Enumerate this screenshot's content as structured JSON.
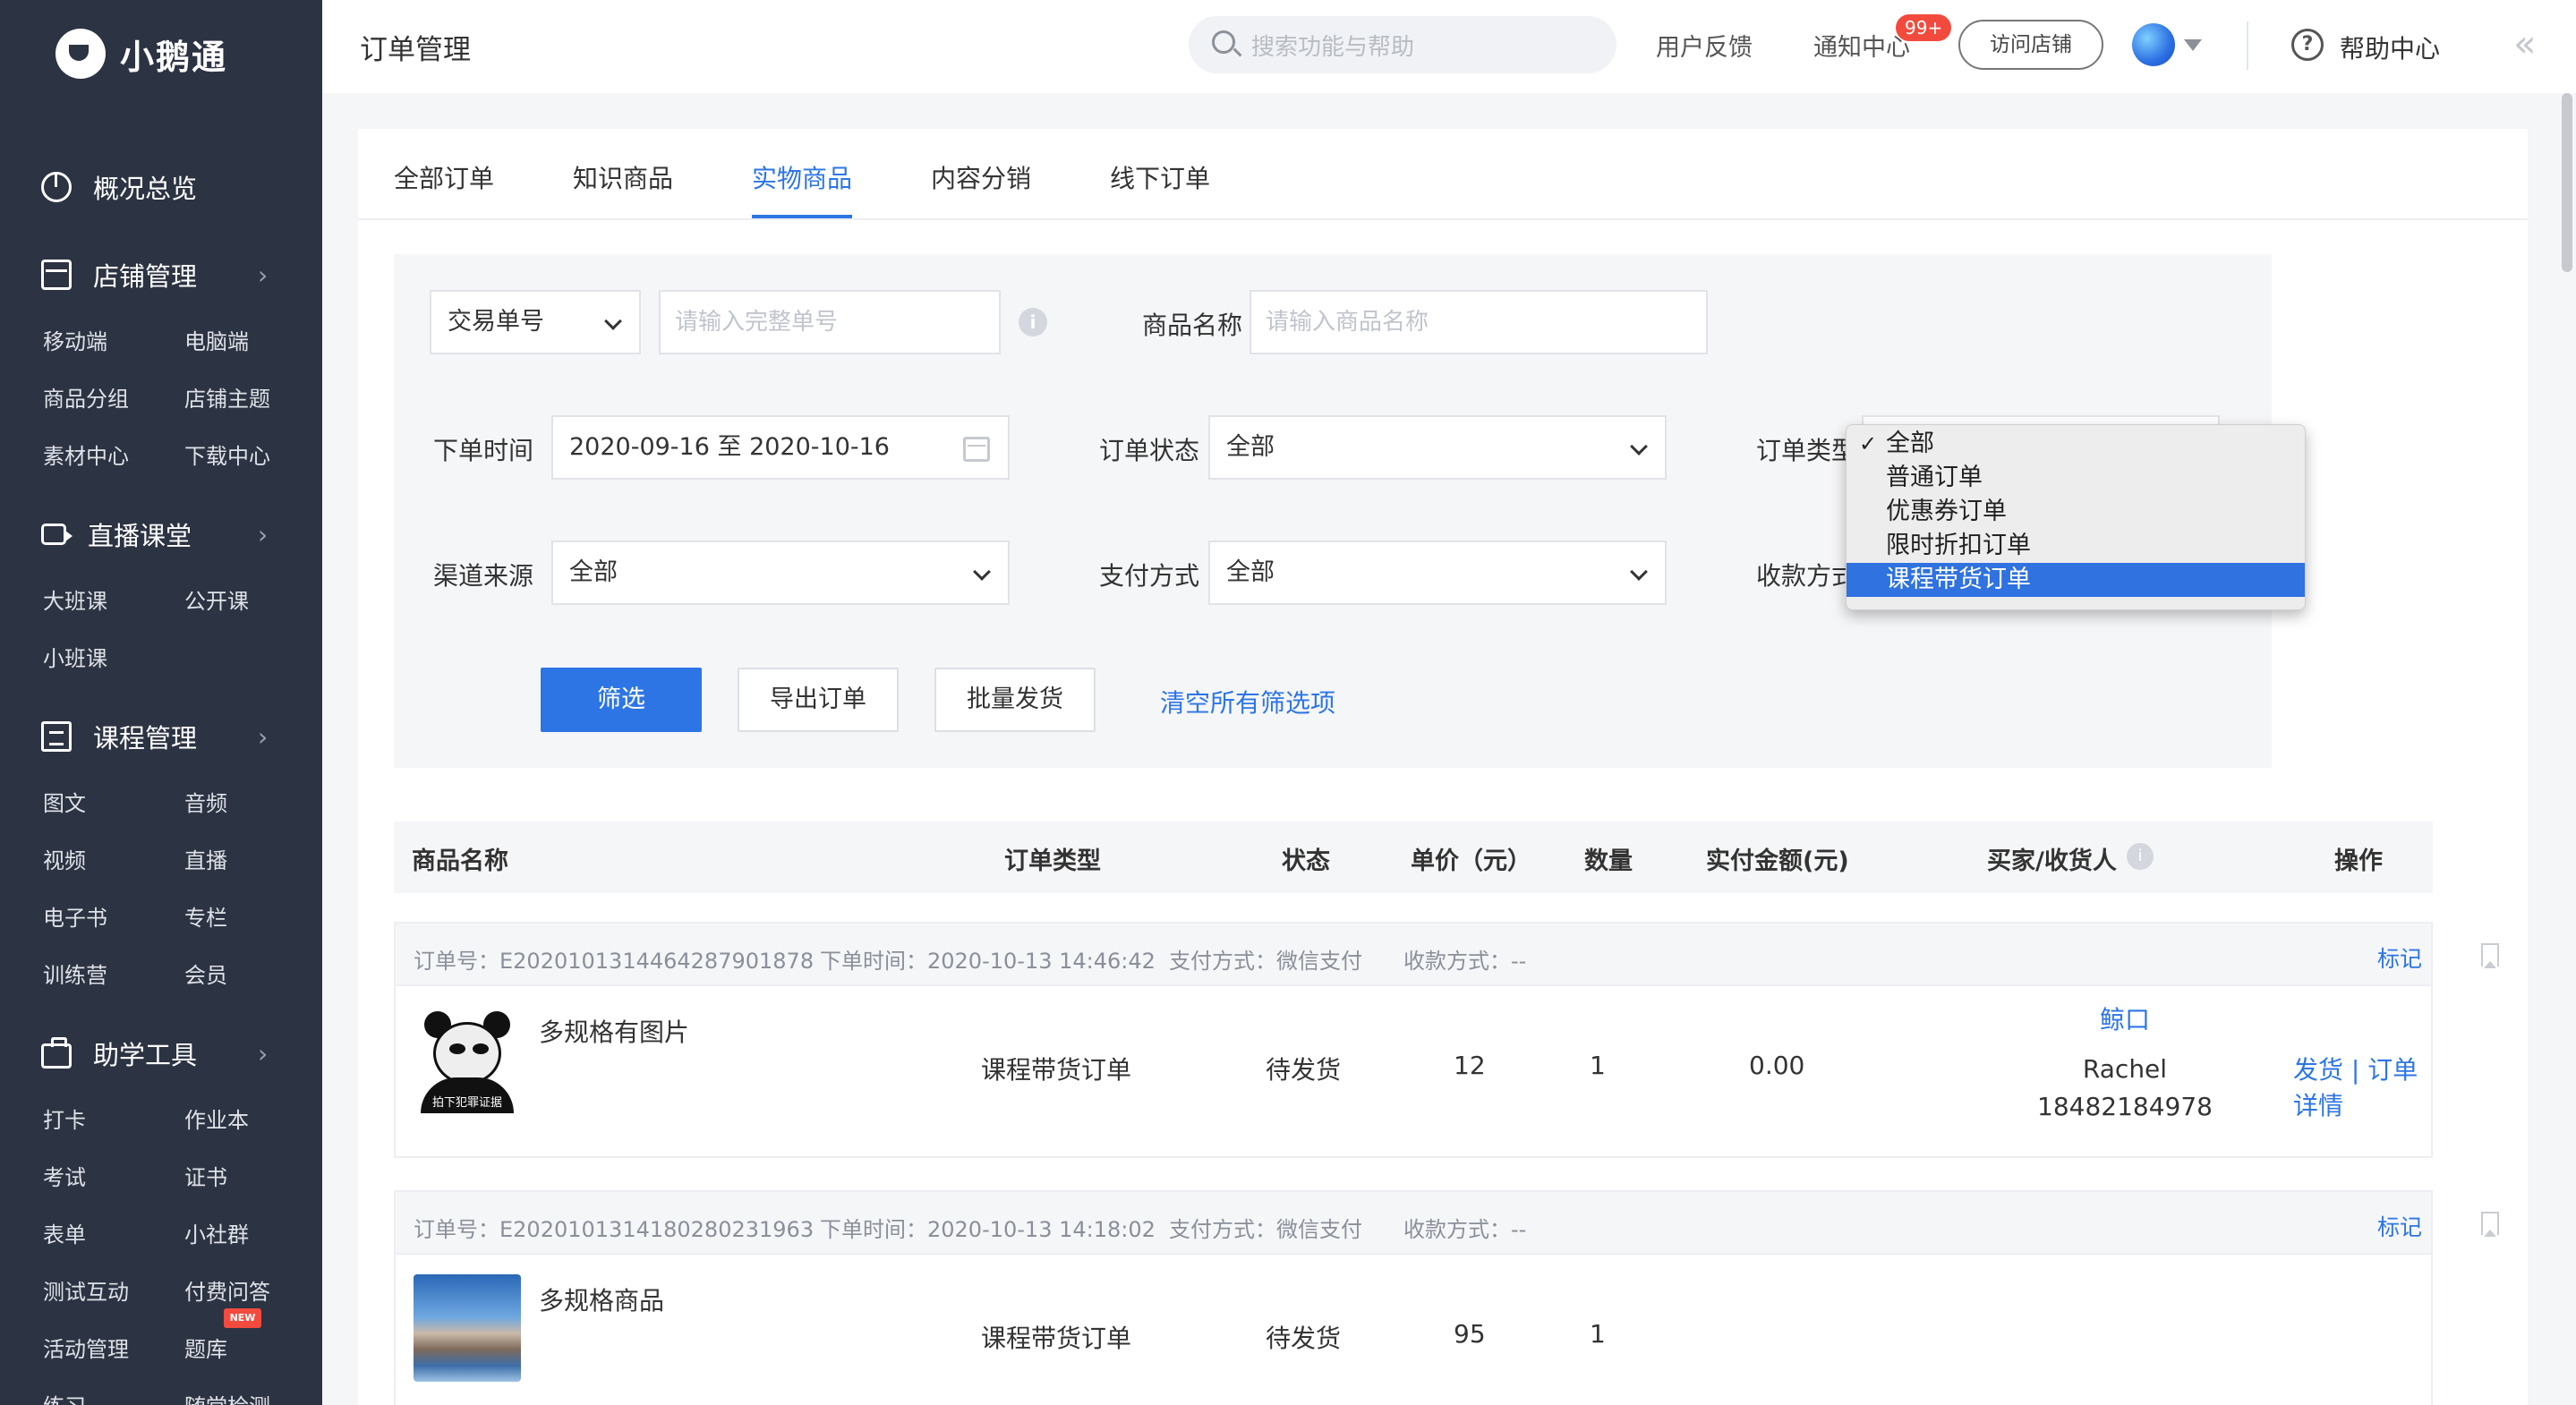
{
  "app": {
    "name": "小鹅通"
  },
  "sidebar": {
    "overview": "概况总览",
    "store": {
      "title": "店铺管理",
      "items": [
        "移动端",
        "电脑端",
        "商品分组",
        "店铺主题",
        "素材中心",
        "下载中心"
      ]
    },
    "live": {
      "title": "直播课堂",
      "items": [
        "大班课",
        "公开课",
        "小班课"
      ]
    },
    "course": {
      "title": "课程管理",
      "items": [
        "图文",
        "音频",
        "视频",
        "直播",
        "电子书",
        "专栏",
        "训练营",
        "会员"
      ]
    },
    "tools": {
      "title": "助学工具",
      "items": [
        "打卡",
        "作业本",
        "考试",
        "证书",
        "表单",
        "小社群",
        "测试互动",
        "付费问答",
        "活动管理",
        "题库",
        "练习",
        "随堂检测"
      ],
      "new_badge": "NEW"
    }
  },
  "topbar": {
    "title": "订单管理",
    "search_placeholder": "搜索功能与帮助",
    "feedback": "用户反馈",
    "notice": "通知中心",
    "notice_badge": "99+",
    "visit_store": "访问店铺",
    "help": "帮助中心"
  },
  "tabs": [
    "全部订单",
    "知识商品",
    "实物商品",
    "内容分销",
    "线下订单"
  ],
  "active_tab": "实物商品",
  "filters": {
    "trade_select": "交易单号",
    "trade_placeholder": "请输入完整单号",
    "product_label": "商品名称",
    "product_placeholder": "请输入商品名称",
    "order_time_label": "下单时间",
    "order_time_value": "2020-09-16 至 2020-10-16",
    "order_status_label": "订单状态",
    "order_status_value": "全部",
    "order_type_label": "订单类型",
    "channel_label": "渠道来源",
    "channel_value": "全部",
    "pay_label": "支付方式",
    "pay_value": "全部",
    "collect_label": "收款方式",
    "filter_button": "筛选",
    "export_button": "导出订单",
    "batch_button": "批量发货",
    "clear_link": "清空所有筛选项"
  },
  "order_type_dropdown": {
    "options": [
      "全部",
      "普通订单",
      "优惠券订单",
      "限时折扣订单",
      "课程带货订单"
    ],
    "checked": "全部",
    "highlighted": "课程带货订单",
    "check_mark": "✓"
  },
  "table": {
    "headers": [
      "商品名称",
      "订单类型",
      "状态",
      "单价（元）",
      "数量",
      "实付金额(元)",
      "买家/收货人",
      "操作"
    ]
  },
  "orders": [
    {
      "order_no": "订单号：E20201013144642879018 78",
      "order_time": "下单时间：2020-10-13 14:46:42",
      "pay_method": "支付方式：微信支付",
      "collect_method": "收款方式：--",
      "mark": "标记",
      "product": "多规格有图片",
      "thumb_caption": "拍下犯罪证据",
      "type": "课程带货订单",
      "status": "待发货",
      "price": "12",
      "qty": "1",
      "paid": "0.00",
      "buyer_nick": "鲸口",
      "buyer_name": "Rachel",
      "buyer_phone": "18482184978",
      "op_ship": "发货",
      "op_sep": "|",
      "op_detail": "订单详情"
    },
    {
      "order_no": "订单号：E20201013141802802319 63",
      "order_time": "下单时间：2020-10-13 14:18:02",
      "pay_method": "支付方式：微信支付",
      "collect_method": "收款方式：--",
      "mark": "标记",
      "product": "多规格商品",
      "type": "课程带货订单",
      "status": "待发货",
      "price": "95",
      "qty": "1"
    }
  ],
  "icons": [
    "logo-icon",
    "overview-icon",
    "store-icon",
    "live-icon",
    "course-icon",
    "tools-icon",
    "search-icon",
    "globe-icon",
    "help-icon",
    "calendar-icon",
    "info-icon",
    "bookmark-icon"
  ],
  "colors": {
    "sidebar": "#2c3342",
    "accent": "#2d75e5",
    "badge": "#f24b3e",
    "dropdown_highlight": "#2f72e0"
  }
}
